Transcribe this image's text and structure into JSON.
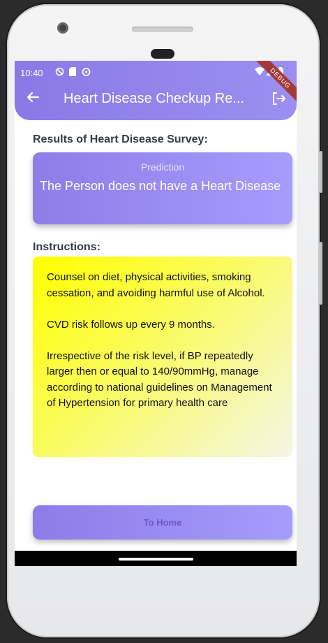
{
  "status_bar": {
    "time": "10:40",
    "debug_label": "DEBUG"
  },
  "app_bar": {
    "title": "Heart Disease Checkup Re...",
    "back_icon": "arrow-back-icon",
    "logout_icon": "logout-icon",
    "color_start": "#8a79e6",
    "color_end": "#9d8ff0"
  },
  "results": {
    "heading": "Results of Heart Disease Survey:",
    "prediction_label": "Prediction",
    "prediction_text": "The Person does not have a Heart Disease"
  },
  "instructions": {
    "heading": "Instructions:",
    "text": "Counsel on diet, physical activities, smoking cessation, and avoiding harmful use of Alcohol.\n\nCVD risk follows up every 9 months.\n\nIrrespective of the risk level, if BP repeatedly larger then or equal to 140/90mmHg, manage according to national guidelines on Management of Hypertension for primary health care"
  },
  "button": {
    "label": "To Home"
  }
}
